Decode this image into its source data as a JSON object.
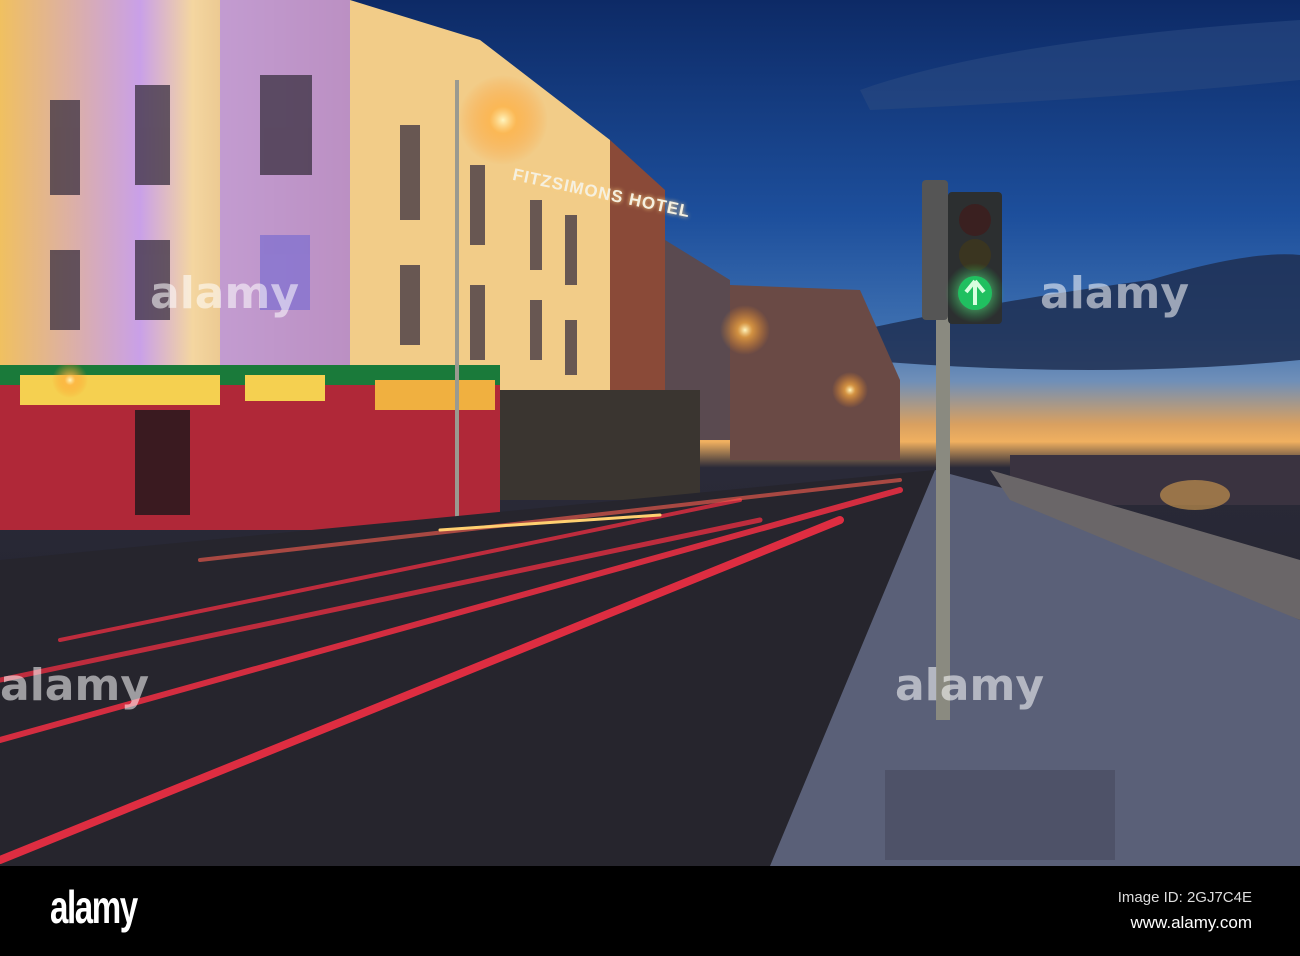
{
  "photo": {
    "hotel_sign": "FITZSIMONS HOTEL",
    "watermark": "alamy"
  },
  "footer": {
    "logo": "alamy",
    "image_id": "Image ID: 2GJ7C4E",
    "url": "www.alamy.com"
  },
  "colors": {
    "sky": "#1d4f9c",
    "sunset": "#f0b060",
    "trail": "#ff3040",
    "signal": "#30e070"
  }
}
